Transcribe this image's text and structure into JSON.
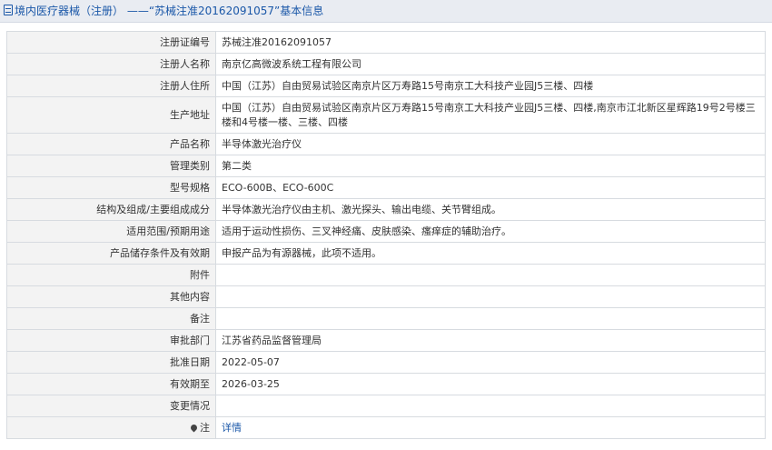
{
  "header": {
    "title": "境内医疗器械（注册） ——“苏械注准20162091057”基本信息"
  },
  "rows": [
    {
      "label": "注册证编号",
      "value": "苏械注准20162091057"
    },
    {
      "label": "注册人名称",
      "value": "南京亿高微波系统工程有限公司"
    },
    {
      "label": "注册人住所",
      "value": "中国（江苏）自由贸易试验区南京片区万寿路15号南京工大科技产业园J5三楼、四楼"
    },
    {
      "label": "生产地址",
      "value": "中国（江苏）自由贸易试验区南京片区万寿路15号南京工大科技产业园J5三楼、四楼,南京市江北新区星辉路19号2号楼三楼和4号楼一楼、三楼、四楼"
    },
    {
      "label": "产品名称",
      "value": "半导体激光治疗仪"
    },
    {
      "label": "管理类别",
      "value": "第二类"
    },
    {
      "label": "型号规格",
      "value": "ECO-600B、ECO-600C"
    },
    {
      "label": "结构及组成/主要组成成分",
      "value": "半导体激光治疗仪由主机、激光探头、输出电缆、关节臂组成。"
    },
    {
      "label": "适用范围/预期用途",
      "value": "适用于运动性损伤、三叉神经痛、皮肤感染、瘙痒症的辅助治疗。"
    },
    {
      "label": "产品储存条件及有效期",
      "value": "申报产品为有源器械，此项不适用。"
    },
    {
      "label": "附件",
      "value": ""
    },
    {
      "label": "其他内容",
      "value": ""
    },
    {
      "label": "备注",
      "value": ""
    },
    {
      "label": "审批部门",
      "value": "江苏省药品监督管理局"
    },
    {
      "label": "批准日期",
      "value": "2022-05-07"
    },
    {
      "label": "有效期至",
      "value": "2026-03-25"
    },
    {
      "label": "变更情况",
      "value": ""
    }
  ],
  "note": {
    "label": "注",
    "icon": "pin-icon",
    "link_text": "详情"
  }
}
